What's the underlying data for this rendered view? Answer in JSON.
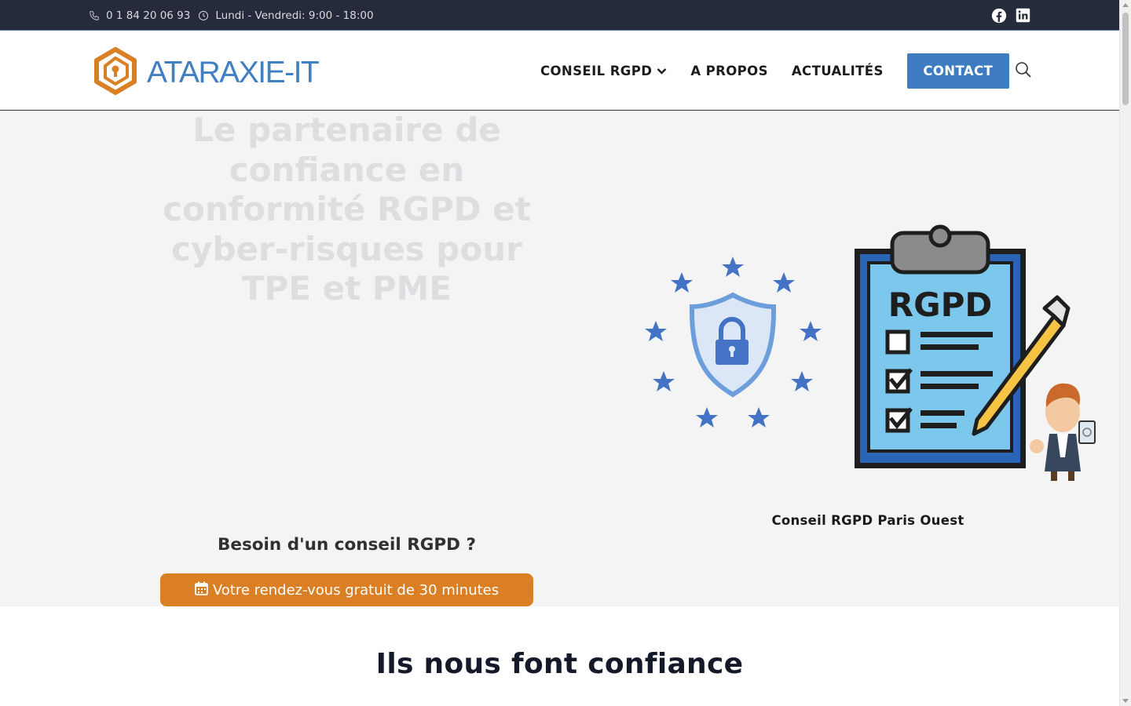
{
  "topbar": {
    "phone": "0 1 84 20 06 93",
    "hours": "Lundi - Vendredi: 9:00 - 18:00",
    "social": [
      "facebook-icon",
      "linkedin-icon"
    ]
  },
  "header": {
    "logo_text": "ATARAXIE-IT",
    "nav": [
      {
        "label": "CONSEIL RGPD",
        "has_dropdown": true
      },
      {
        "label": "A PROPOS"
      },
      {
        "label": "ACTUALITÉS"
      }
    ],
    "contact_label": "CONTACT"
  },
  "hero": {
    "title": "Le partenaire de confiance en conformité RGPD et cyber-risques pour TPE et PME",
    "illustration_label": "RGPD",
    "caption": "Conseil RGPD Paris Ouest",
    "question": "Besoin d'un conseil RGPD ?",
    "cta_label": "Votre rendez-vous gratuit de 30 minutes"
  },
  "trust": {
    "title": "Ils nous font confiance"
  },
  "colors": {
    "topbar_bg": "#252b3b",
    "brand_blue": "#3d7cc0",
    "brand_orange": "#da7f23",
    "hero_bg": "#f4f4f4"
  }
}
